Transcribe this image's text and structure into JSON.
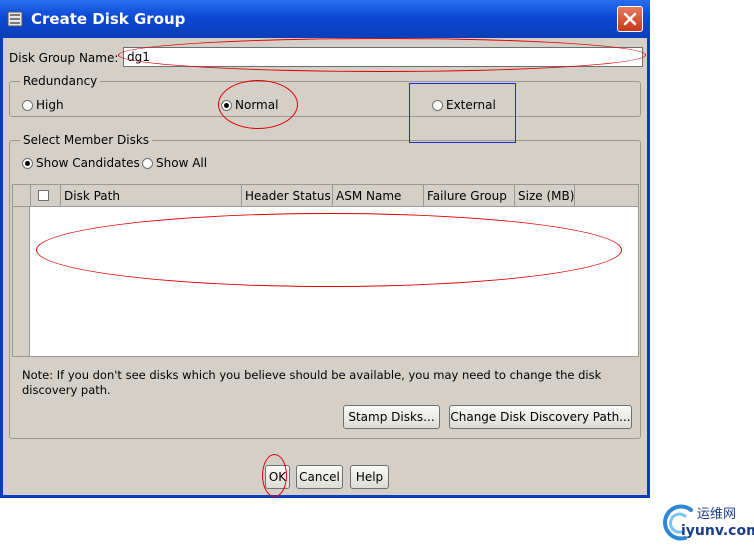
{
  "window": {
    "title": "Create Disk Group"
  },
  "disk_group_name": {
    "label": "Disk Group Name:",
    "value": "dg1"
  },
  "redundancy": {
    "legend": "Redundancy",
    "options": [
      {
        "label": "High",
        "selected": false
      },
      {
        "label": "Normal",
        "selected": true
      },
      {
        "label": "External",
        "selected": false
      }
    ]
  },
  "member_disks": {
    "legend": "Select Member Disks",
    "filters": [
      {
        "label": "Show Candidates",
        "selected": true
      },
      {
        "label": "Show All",
        "selected": false
      }
    ],
    "columns": [
      "Disk Path",
      "Header Status",
      "ASM Name",
      "Failure Group",
      "Size (MB)"
    ],
    "rows": [],
    "note": "Note: If you don't see disks which you believe should be available, you may need to change the disk discovery path.",
    "stamp_button": "Stamp Disks...",
    "discovery_button": "Change Disk Discovery Path..."
  },
  "footer": {
    "ok": "OK",
    "cancel": "Cancel",
    "help": "Help"
  },
  "watermark": {
    "line1": "运维网",
    "line2": "iyunv.com"
  },
  "colors": {
    "title_bar": "#0a3fb8",
    "dialog_bg": "#d4d0c8",
    "annotation_red": "#e00000",
    "annotation_blue": "#1a2fd6"
  },
  "icons": {
    "app": "dialog-icon",
    "close": "close-icon"
  }
}
